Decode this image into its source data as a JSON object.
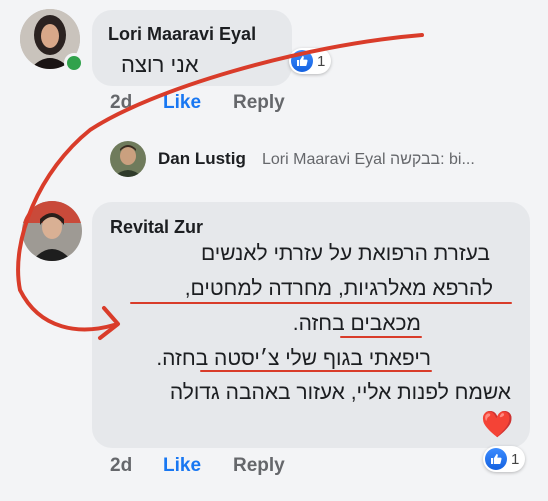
{
  "comment1": {
    "author": "Lori Maaravi Eyal",
    "text": "אני רוצה",
    "time": "2d",
    "like_label": "Like",
    "reply_label": "Reply",
    "reaction_count": "1"
  },
  "reply_preview": {
    "author": "Dan Lustig",
    "snippet": "Lori Maaravi Eyal בבקשה: bi..."
  },
  "comment2": {
    "author": "Revital Zur",
    "lines": [
      "בעזרת הרפואת על עזרתי לאנשים",
      "להרפא מאלרגיות, מחרדה למחטים,",
      "מכאבים בחזה.",
      "ריפאתי בגוף שלי צ׳יסטה בחזה.",
      "אשמח לפנות אליי, אעזור באהבה גדולה"
    ],
    "emoji": "❤️",
    "time": "2d",
    "like_label": "Like",
    "reply_label": "Reply",
    "reaction_count": "1"
  },
  "colors": {
    "annotation": "#d93c2a",
    "like": "#1877f2",
    "bubble": "#e6e8eb",
    "online": "#31a24c"
  },
  "icons": [
    "thumbs-up-icon",
    "heart-icon",
    "online-status-icon"
  ]
}
